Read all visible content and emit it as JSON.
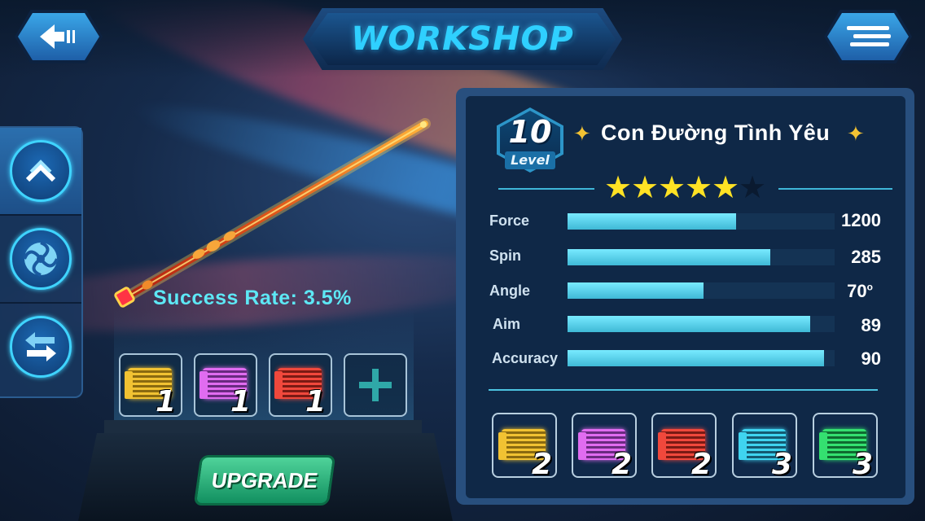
{
  "header": {
    "title": "WORKSHOP"
  },
  "sidebar": {
    "buttons": [
      {
        "icon": "chevron-up-icon",
        "active": true
      },
      {
        "icon": "swirl-icon",
        "active": false
      },
      {
        "icon": "swap-arrows-icon",
        "active": false
      }
    ]
  },
  "upgrade": {
    "success_rate_label": "Success Rate: 3.5%",
    "slots": [
      {
        "chip": "yellow",
        "count": "1"
      },
      {
        "chip": "purple",
        "count": "1"
      },
      {
        "chip": "red",
        "count": "1"
      }
    ],
    "add_slot_icon": "plus-icon",
    "button_label": "UPGRADE"
  },
  "cue": {
    "level": "10",
    "level_label": "Level",
    "name": "Con Đường Tình Yêu",
    "stars_filled": 5,
    "stars_total": 6,
    "stats": [
      {
        "label": "Force",
        "value": "1200",
        "fill": 0.63
      },
      {
        "label": "Spin",
        "value": "285",
        "fill": 0.76
      },
      {
        "label": "Angle",
        "value": "70",
        "unit": "o",
        "fill": 0.51
      },
      {
        "label": "Aim",
        "value": "89",
        "fill": 0.91
      },
      {
        "label": "Accuracy",
        "value": "90",
        "fill": 0.96
      }
    ]
  },
  "inventory": [
    {
      "chip": "yellow",
      "count": "2"
    },
    {
      "chip": "purple",
      "count": "2"
    },
    {
      "chip": "red",
      "count": "2"
    },
    {
      "chip": "cyan",
      "count": "3"
    },
    {
      "chip": "green",
      "count": "3"
    }
  ],
  "colors": {
    "accent": "#3fd4ff",
    "upgrade_button": "#1fae72",
    "star": "#ffe224",
    "bar": "#5cd3ea"
  }
}
